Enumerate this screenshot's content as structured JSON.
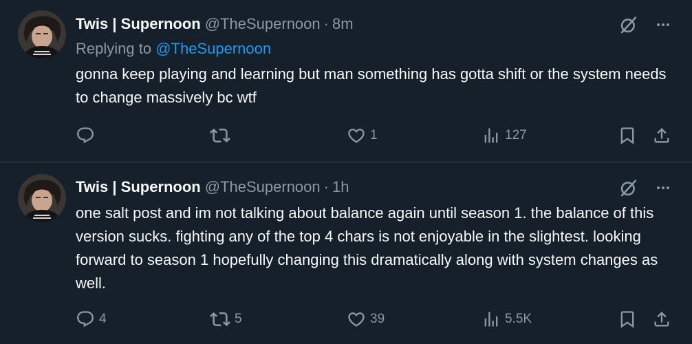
{
  "tweets": [
    {
      "display_name": "Twis | Supernoon",
      "handle": "@TheSupernoon",
      "separator": "·",
      "time": "8m",
      "replying_prefix": "Replying to ",
      "replying_to": "@TheSupernoon",
      "text": "gonna keep playing and learning but man something has gotta shift or the system needs to change massively bc wtf",
      "stats": {
        "replies": "",
        "retweets": "",
        "likes": "1",
        "views": "127"
      }
    },
    {
      "display_name": "Twis | Supernoon",
      "handle": "@TheSupernoon",
      "separator": "·",
      "time": "1h",
      "text": "one salt post and im not talking about balance again until season 1. the balance of this version sucks. fighting any of the top 4 chars is not enjoyable in the slightest. looking forward to season 1 hopefully changing this dramatically along with system changes as well.",
      "stats": {
        "replies": "4",
        "retweets": "5",
        "likes": "39",
        "views": "5.5K"
      }
    }
  ],
  "icons": {
    "grok": "grok-icon",
    "more": "more-icon",
    "reply": "reply-icon",
    "retweet": "retweet-icon",
    "like": "like-icon",
    "views": "views-icon",
    "bookmark": "bookmark-icon",
    "share": "share-icon"
  },
  "colors": {
    "background": "#15202b",
    "text": "#f7f9f9",
    "secondary": "#8b98a5",
    "mention": "#1d9bf0",
    "divider": "#38444d"
  }
}
